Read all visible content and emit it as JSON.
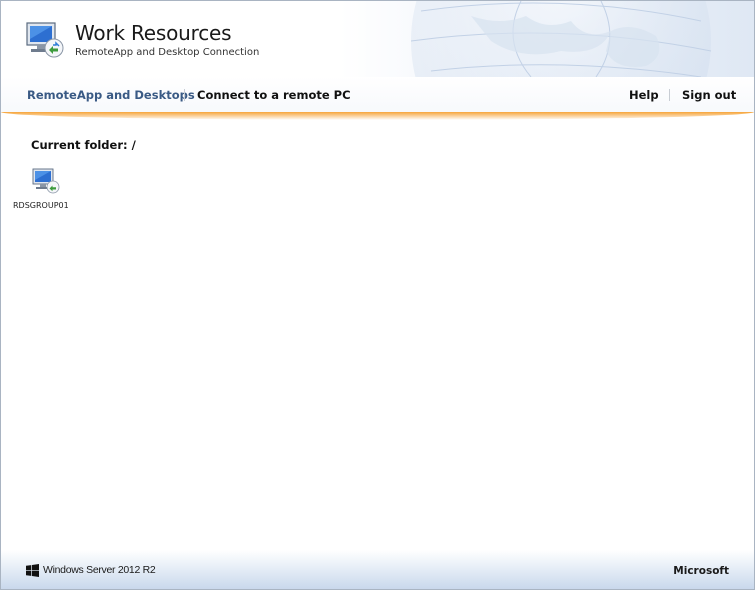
{
  "header": {
    "title": "Work Resources",
    "subtitle": "RemoteApp and Desktop Connection",
    "icon": "remote-desktop-icon"
  },
  "nav": {
    "tabs": [
      {
        "label": "RemoteApp and Desktops",
        "active": true
      },
      {
        "label": "Connect to a remote PC",
        "active": false
      }
    ],
    "help_label": "Help",
    "signout_label": "Sign out"
  },
  "content": {
    "current_folder_label": "Current folder: /",
    "items": [
      {
        "label": "RDSGROUP01",
        "icon": "remote-desktop-icon"
      }
    ]
  },
  "footer": {
    "os_name": "Windows Server 2012 R2",
    "brand": "Microsoft",
    "logo_icon": "windows-logo-icon"
  },
  "colors": {
    "accent_nav_active": "#3a5a85",
    "orange_divider": "#f6a53a",
    "footer_gradient_end": "#c9d8ec"
  }
}
